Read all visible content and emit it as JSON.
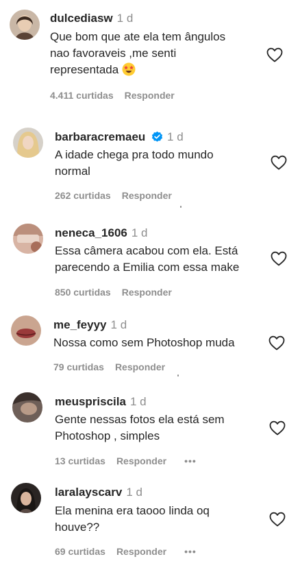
{
  "comments": [
    {
      "username": "dulcediasw",
      "age": "1 d",
      "lines": [
        "Que bom que ate ela tem ângulos",
        "nao favoraveis ,me senti",
        "representada"
      ],
      "emoji": "star-struck-emoji",
      "likes": "4.411 curtidas",
      "reply": "Responder"
    },
    {
      "username": "barbaracremaeu",
      "verified": true,
      "age": "1 d",
      "lines": [
        "A idade chega pra todo mundo",
        "normal"
      ],
      "likes": "262 curtidas",
      "reply": "Responder"
    },
    {
      "username": "neneca_1606",
      "age": "1 d",
      "lines": [
        "Essa câmera acabou com ela. Está",
        "parecendo a Emilia com essa make"
      ],
      "likes": "850 curtidas",
      "reply": "Responder"
    },
    {
      "username": "me_feyyy",
      "age": "1 d",
      "lines": [
        "Nossa como sem Photoshop muda"
      ],
      "likes": "79 curtidas",
      "reply": "Responder"
    },
    {
      "username": "meuspriscila",
      "age": "1 d",
      "lines": [
        "Gente nessas fotos ela está sem",
        "Photoshop , simples"
      ],
      "likes": "13 curtidas",
      "reply": "Responder",
      "more": "•••"
    },
    {
      "username": "laralayscarv",
      "age": "1 d",
      "lines": [
        "Ela menina era taooo linda oq",
        "houve??"
      ],
      "likes": "69 curtidas",
      "reply": "Responder",
      "more": "•••"
    }
  ],
  "icons": {
    "like": "heart-outline-icon",
    "verified": "verified-badge-icon",
    "more": "more-options-icon"
  },
  "colors": {
    "text": "#262626",
    "secondary": "#8e8e8e",
    "verified": "#0095f6"
  }
}
